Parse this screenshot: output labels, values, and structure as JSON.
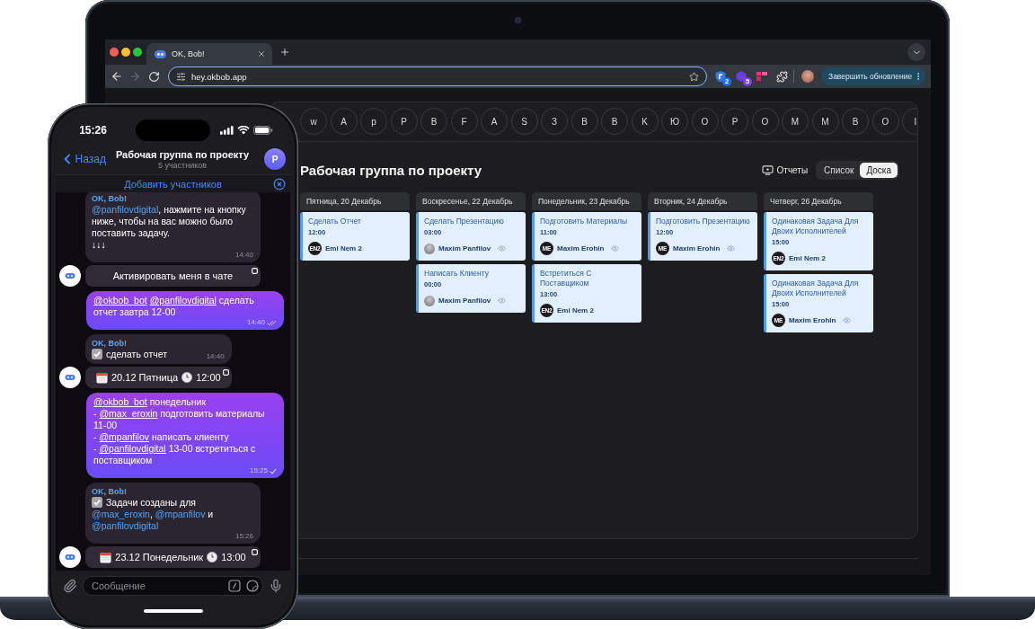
{
  "browser": {
    "tabs": [
      {
        "title": "OK, Bob!",
        "selected": true
      }
    ],
    "forward_disabled": true,
    "address": "hey.okbob.app",
    "extensions": [
      {
        "kind": "shield",
        "badge": "2"
      },
      {
        "kind": "hexagon",
        "badge": "5"
      },
      {
        "kind": "grid"
      }
    ],
    "update_button": "Завершить обновление"
  },
  "board": {
    "members": [
      "w",
      "A",
      "p",
      "P",
      "B",
      "F",
      "A",
      "S",
      "З",
      "B",
      "B",
      "K",
      "Ю",
      "O",
      "P",
      "O",
      "M",
      "M",
      "B",
      "O",
      "I"
    ],
    "title": "Рабочая группа по проекту",
    "reports_button": "Отчеты",
    "views": [
      {
        "label": "Список",
        "selected": false
      },
      {
        "label": "Доска",
        "selected": true
      }
    ],
    "columns": [
      {
        "date": "Пятница, 20 Декабрь",
        "tasks": [
          {
            "title": "Сделать Отчет",
            "time": "12:00",
            "assignee": {
              "kind": "initials",
              "initials": "EN2",
              "name": "Emi Nem 2"
            },
            "eye_icon": false
          }
        ]
      },
      {
        "date": "Воскресенье, 22 Декабрь",
        "tasks": [
          {
            "title": "Сделать Презентацию",
            "time": "03:00",
            "assignee": {
              "kind": "photo",
              "name": "Maxim Panfilov"
            },
            "eye_icon": true
          },
          {
            "title": "Написать Клиенту",
            "time": "00:00",
            "assignee": {
              "kind": "photo",
              "name": "Maxim Panfilov"
            },
            "eye_icon": true
          }
        ]
      },
      {
        "date": "Понедельник, 23 Декабрь",
        "tasks": [
          {
            "title": "Подготовить Материалы",
            "time": "11:00",
            "assignee": {
              "kind": "initials",
              "initials": "ME",
              "name": "Maxim Erohin"
            },
            "eye_icon": true
          },
          {
            "title": "Встретиться С Поставщиком",
            "time": "13:00",
            "assignee": {
              "kind": "initials",
              "initials": "EN2",
              "name": "Emi Nem 2"
            },
            "eye_icon": false
          }
        ]
      },
      {
        "date": "Вторник, 24 Декабрь",
        "tasks": [
          {
            "title": "Подготовить Презентацию",
            "time": "12:00",
            "assignee": {
              "kind": "initials",
              "initials": "ME",
              "name": "Maxim Erohin"
            },
            "eye_icon": true
          }
        ]
      },
      {
        "date": "Четверг, 26 Декабрь",
        "tasks": [
          {
            "title": "Одинаковая Задача Для Двоих Исполнителей",
            "time": "15:00",
            "assignee": {
              "kind": "initials",
              "initials": "EN2",
              "name": "Emi Nem 2"
            },
            "eye_icon": false
          },
          {
            "title": "Одинаковая Задача Для Двоих Исполнителей",
            "time": "15:00",
            "assignee": {
              "kind": "initials",
              "initials": "ME",
              "name": "Maxim Erohin"
            },
            "eye_icon": true
          }
        ]
      }
    ]
  },
  "phone": {
    "time": "15:26",
    "back_button": "Назад",
    "title": "Рабочая группа по проекту",
    "subtitle": "5 участников",
    "avatar_letter": "Р",
    "banner": "Добавить участников",
    "messages": [
      {
        "kind": "incoming",
        "sender": "OK, Bob!",
        "check_icon": false,
        "parts": [
          {
            "kind": "mention",
            "text": "@panfilovdigital"
          },
          {
            "kind": "text",
            "text": ", нажмите на кнопку ниже, чтобы на вас можно было поставить задачу.\n↓↓↓"
          }
        ],
        "time": "14:40",
        "bot_avatar": true,
        "buttons": [
          {
            "kind": "action",
            "label": "Активировать меня в чате"
          }
        ]
      },
      {
        "kind": "outgoing",
        "parts": [
          {
            "kind": "mention",
            "text": "@okbob_bot"
          },
          {
            "kind": "mention",
            "text": "@panfilovdigital"
          },
          {
            "kind": "text",
            "text": " сделать отчет завтра 12-00"
          }
        ],
        "time": "14:40",
        "read": true
      },
      {
        "kind": "incoming",
        "sender": "OK, Bob!",
        "check_icon": true,
        "parts": [
          {
            "kind": "text",
            "text": "сделать отчет"
          }
        ],
        "time": "14:40",
        "bot_avatar": true,
        "buttons": [
          {
            "kind": "schedule",
            "date": "20.12 Пятница",
            "time": "12:00"
          }
        ]
      },
      {
        "kind": "outgoing",
        "parts": [
          {
            "kind": "mention",
            "text": "@okbob_bot"
          },
          {
            "kind": "text",
            "text": " понедельник\n- "
          },
          {
            "kind": "mention",
            "text": "@max_eroxin"
          },
          {
            "kind": "text",
            "text": " подготовить материалы 11-00\n- "
          },
          {
            "kind": "mention",
            "text": "@mpanfilov"
          },
          {
            "kind": "text",
            "text": " написать клиенту\n- "
          },
          {
            "kind": "mention",
            "text": "@panfilovdigital"
          },
          {
            "kind": "text",
            "text": " 13-00 встретиться с поставщиком"
          }
        ],
        "time": "15:25",
        "read": false
      },
      {
        "kind": "incoming",
        "sender": "OK, Bob!",
        "check_icon": true,
        "parts": [
          {
            "kind": "text",
            "text": "Задачи созданы для "
          },
          {
            "kind": "mention",
            "text": "@max_eroxin"
          },
          {
            "kind": "text",
            "text": ", "
          },
          {
            "kind": "mention",
            "text": "@mpanfilov"
          },
          {
            "kind": "text",
            "text": " и "
          },
          {
            "kind": "mention",
            "text": "@panfilovdigital"
          }
        ],
        "time": "15:26",
        "bot_avatar": true,
        "buttons": [
          {
            "kind": "schedule",
            "date": "23.12 Понедельник",
            "time": "13:00"
          }
        ]
      }
    ],
    "input": {
      "placeholder": "Сообщение"
    }
  }
}
